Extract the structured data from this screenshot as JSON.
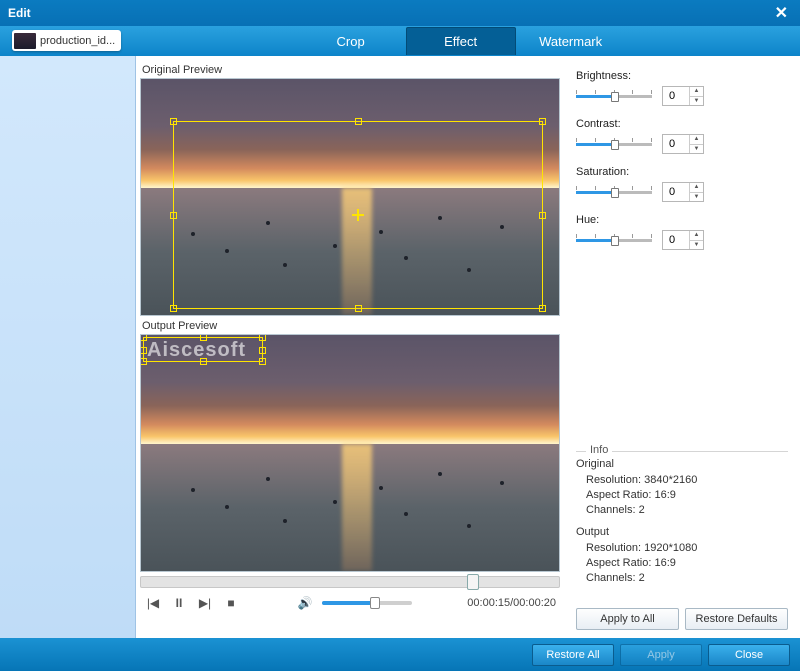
{
  "window": {
    "title": "Edit"
  },
  "fileItem": {
    "name": "production_id..."
  },
  "tabs": {
    "crop": "Crop",
    "effect": "Effect",
    "watermark": "Watermark",
    "active": "effect"
  },
  "labels": {
    "originalPreview": "Original Preview",
    "outputPreview": "Output Preview"
  },
  "watermarkText": "Aiscesoft",
  "playback": {
    "current": "00:00:15",
    "total": "00:00:20",
    "combined": "00:00:15/00:00:20"
  },
  "sliders": {
    "brightness": {
      "label": "Brightness:",
      "value": "0"
    },
    "contrast": {
      "label": "Contrast:",
      "value": "0"
    },
    "saturation": {
      "label": "Saturation:",
      "value": "0"
    },
    "hue": {
      "label": "Hue:",
      "value": "0"
    }
  },
  "info": {
    "heading": "Info",
    "original": {
      "heading": "Original",
      "resolution_label": "Resolution:",
      "resolution_value": "3840*2160",
      "aspect_label": "Aspect Ratio:",
      "aspect_value": "16:9",
      "channels_label": "Channels:",
      "channels_value": "2"
    },
    "output": {
      "heading": "Output",
      "resolution_label": "Resolution:",
      "resolution_value": "1920*1080",
      "aspect_label": "Aspect Ratio:",
      "aspect_value": "16:9",
      "channels_label": "Channels:",
      "channels_value": "2"
    }
  },
  "buttons": {
    "applyAll": "Apply to All",
    "restoreDefaults": "Restore Defaults",
    "restoreAll": "Restore All",
    "apply": "Apply",
    "close": "Close"
  }
}
